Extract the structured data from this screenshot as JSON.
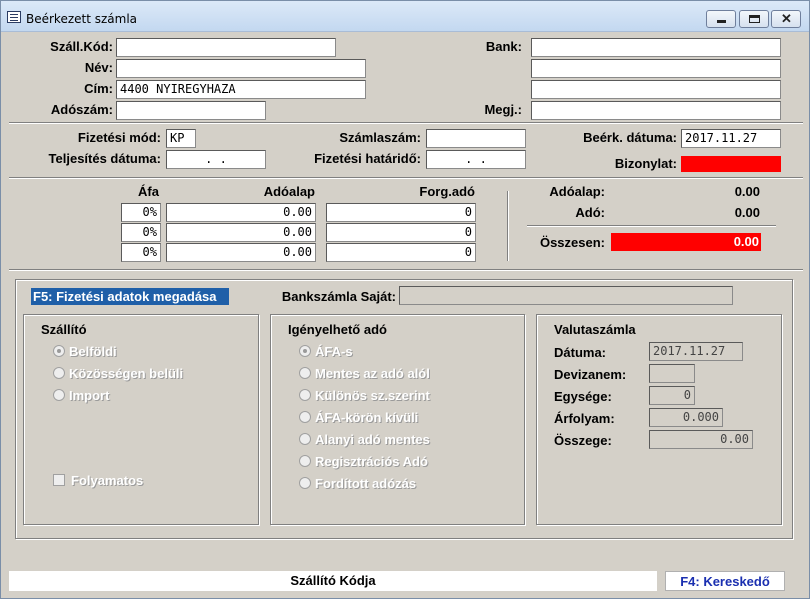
{
  "window": {
    "title": "Beérkezett számla",
    "minimize_label": "",
    "maximize_label": "",
    "close_label": "✕"
  },
  "header": {
    "supplier_code_label": "Száll.Kód:",
    "supplier_code_value": "",
    "name_label": "Név:",
    "name_value": "",
    "address_label": "Cím:",
    "address_value": "4400 NYIREGYHAZA",
    "tax_number_label": "Adószám:",
    "tax_number_value": "",
    "bank_label": "Bank:",
    "bank_value_1": "",
    "bank_value_2": "",
    "bank_value_3": "",
    "note_label": "Megj.:",
    "note_value": ""
  },
  "invoice": {
    "payment_method_label": "Fizetési mód:",
    "payment_method_value": "KP",
    "fulfillment_date_label": "Teljesítés dátuma:",
    "fulfillment_date_value": ". .",
    "invoice_number_label": "Számlaszám:",
    "invoice_number_value": "",
    "payment_deadline_label": "Fizetési határidő:",
    "payment_deadline_value": ". .",
    "received_date_label": "Beérk. dátuma:",
    "received_date_value": "2017.11.27",
    "voucher_label": "Bizonylat:"
  },
  "vat": {
    "col_vat": "Áfa",
    "col_base": "Adóalap",
    "col_turnover_tax": "Forg.adó",
    "rows": [
      {
        "rate": "0%",
        "base": "0.00",
        "tax": "0"
      },
      {
        "rate": "0%",
        "base": "0.00",
        "tax": "0"
      },
      {
        "rate": "0%",
        "base": "0.00",
        "tax": "0"
      }
    ],
    "sum_base_label": "Adóalap:",
    "sum_base_value": "0.00",
    "sum_tax_label": "Adó:",
    "sum_tax_value": "0.00",
    "total_label": "Összesen:",
    "total_value": "0.00"
  },
  "payment": {
    "f5_label": "F5: Fizetési adatok megadása",
    "own_bank_label": "Bankszámla Saját:",
    "own_bank_value": ""
  },
  "supplier_group": {
    "title": "Szállító",
    "options": [
      "Belföldi",
      "Közösségen belüli",
      "Import"
    ],
    "continuous_label": "Folyamatos"
  },
  "claimable_tax_group": {
    "title": "Igényelhető adó",
    "options": [
      "ÁFA-s",
      "Mentes az adó alól",
      "Különös sz.szerint",
      "ÁFA-körön kívüli",
      "Alanyi adó mentes",
      "Regisztrációs Adó",
      "Fordított adózás"
    ]
  },
  "currency_group": {
    "title": "Valutaszámla",
    "date_label": "Dátuma:",
    "date_value": "2017.11.27",
    "currency_label": "Devizanem:",
    "currency_value": "",
    "unit_label": "Egysége:",
    "unit_value": "0",
    "rate_label": "Árfolyam:",
    "rate_value": "0.000",
    "amount_label": "Összege:",
    "amount_value": "0.00"
  },
  "statusbar": {
    "text": "Szállító Kódja",
    "f4_label": "F4: Kereskedő"
  },
  "colors": {
    "window_bg": "#d4d0c8",
    "highlight_red": "#ff0000",
    "f5_bg": "#1f5fa8",
    "f4_text": "#1a2fb0"
  }
}
